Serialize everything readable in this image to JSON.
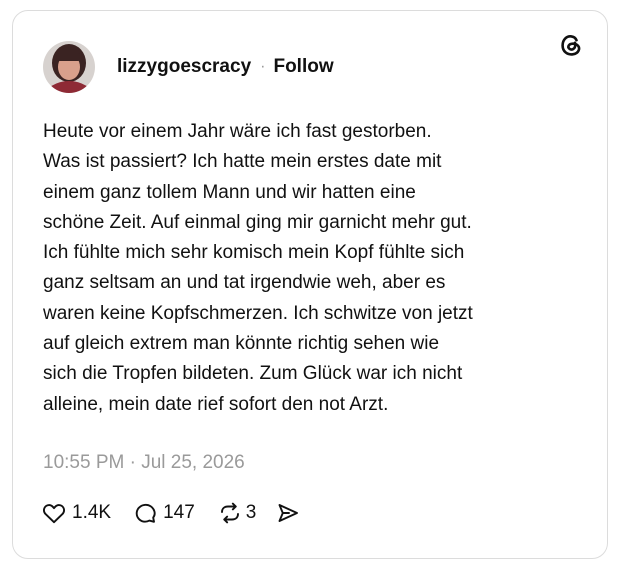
{
  "post": {
    "username": "lizzygoescracy",
    "separator": "·",
    "follow_label": "Follow",
    "body_lines": [
      "Heute vor einem Jahr wäre ich fast gestorben.",
      "Was ist passiert? Ich hatte mein erstes date mit",
      "einem ganz tollem Mann und wir hatten eine",
      "schöne Zeit. Auf einmal ging mir garnicht mehr gut.",
      "Ich fühlte mich sehr komisch mein Kopf fühlte sich",
      "ganz seltsam an und tat irgendwie weh, aber es",
      "waren keine Kopfschmerzen. Ich schwitze von jetzt",
      "auf gleich extrem man könnte richtig sehen wie",
      "sich die Tropfen bildeten. Zum Glück war ich nicht",
      "alleine, mein date rief sofort den not Arzt."
    ],
    "timestamp": "10:55 PM · Jul 25, 2026",
    "stats": {
      "likes": "1.4K",
      "replies": "147",
      "reposts": "3"
    }
  },
  "icons": {
    "logo": "threads-logo-icon",
    "like": "heart-icon",
    "reply": "speech-bubble-icon",
    "repost": "repost-icon",
    "share": "send-icon"
  },
  "colors": {
    "text": "#111111",
    "muted": "#9a9a9a",
    "border": "#dcdcdc"
  }
}
